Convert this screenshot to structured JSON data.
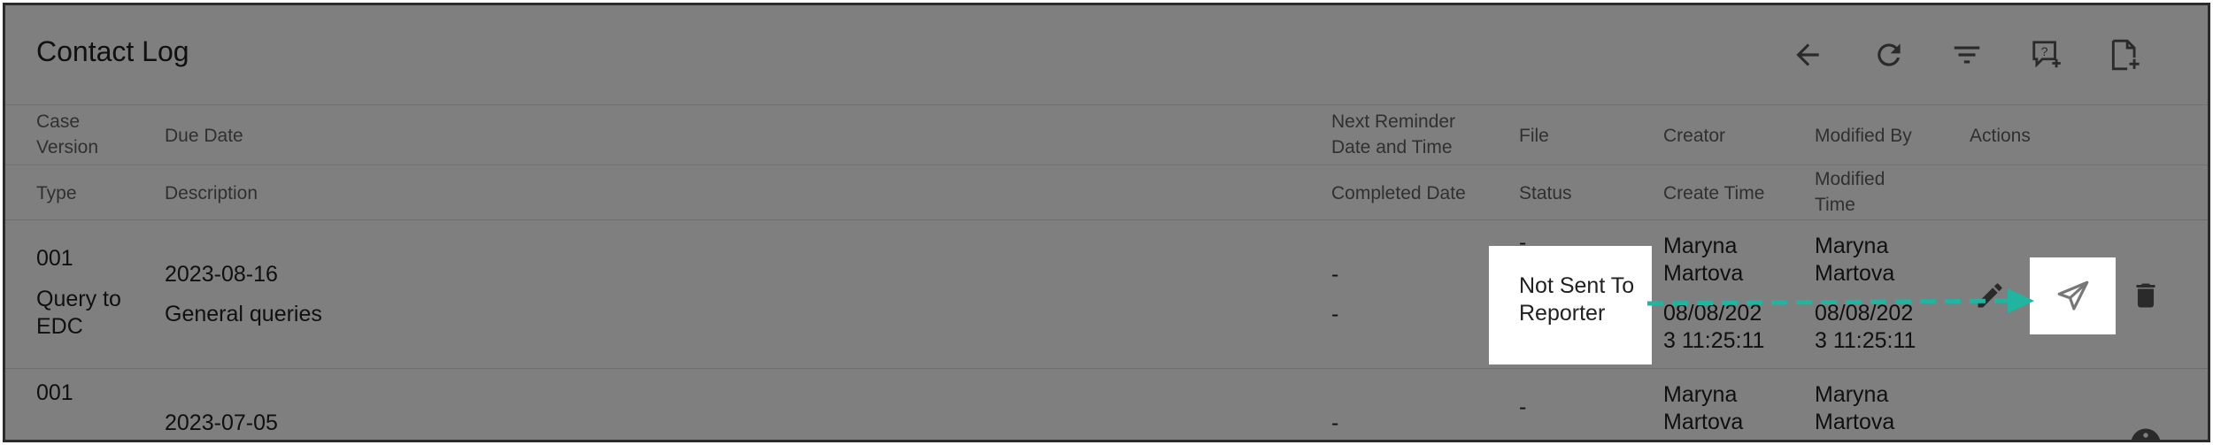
{
  "page": {
    "title": "Contact Log"
  },
  "toolbar": {
    "icons": [
      "back-arrow-icon",
      "refresh-icon",
      "filter-icon",
      "add-help-icon",
      "add-document-icon"
    ]
  },
  "headers": {
    "row1": {
      "case_version": "Case Version",
      "due_date": "Due Date",
      "next_reminder": "Next Reminder Date and Time",
      "file": "File",
      "creator": "Creator",
      "modified_by": "Modified By",
      "actions": "Actions"
    },
    "row2": {
      "type": "Type",
      "description": "Description",
      "completed_date": "Completed Date",
      "status": "Status",
      "create_time": "Create Time",
      "modified_time": "Modified Time"
    }
  },
  "rows": [
    {
      "case_version": "001",
      "type": "Query to EDC",
      "due_date": "2023-08-16",
      "description": "General queries",
      "next_reminder": "-",
      "completed_date": "-",
      "file": "-",
      "status": "Not Sent To Reporter",
      "creator": "Maryna Martova",
      "create_time": "08/08/2023 11:25:11",
      "modified_by": "Maryna Martova",
      "modified_time": "08/08/2023 11:25:11"
    },
    {
      "case_version": "001",
      "due_date": "2023-07-05",
      "next_reminder": "-",
      "file": "-",
      "creator": "Maryna Martova",
      "modified_by": "Maryna Martova"
    }
  ],
  "colors": {
    "overlay": "rgba(0,0,0,0.5)",
    "annotation_arrow": "#1fb5a0",
    "text": "#212121"
  }
}
